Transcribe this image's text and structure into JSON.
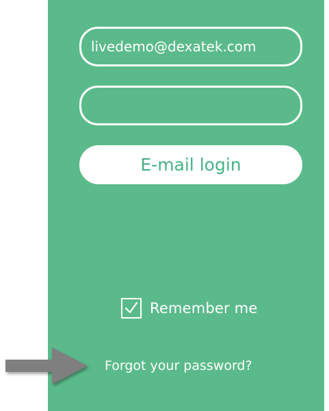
{
  "login_form": {
    "email_value": "livedemo@dexatek.com",
    "password_value": "",
    "login_button_label": "E-mail login",
    "remember_label": "Remember me",
    "remember_checked": true,
    "forgot_link": "Forgot your password?"
  },
  "annotation": {
    "icon": "arrow-right-icon",
    "color": "#7f7f7f"
  },
  "colors": {
    "panel_background": "#5bba8b",
    "button_text": "#45b283",
    "foreground": "#ffffff"
  }
}
